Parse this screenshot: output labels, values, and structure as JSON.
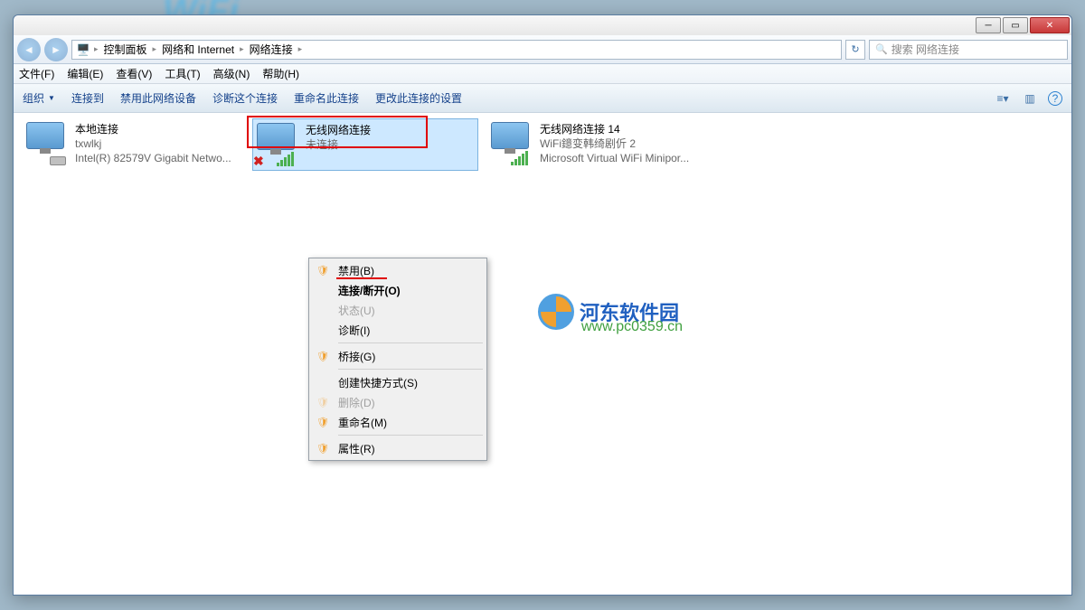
{
  "breadcrumb": {
    "p1": "控制面板",
    "p2": "网络和 Internet",
    "p3": "网络连接"
  },
  "search": {
    "placeholder": "搜索 网络连接"
  },
  "menubar": {
    "file": "文件(F)",
    "edit": "编辑(E)",
    "view": "查看(V)",
    "tools": "工具(T)",
    "advanced": "高级(N)",
    "help": "帮助(H)"
  },
  "toolbar": {
    "organize": "组织",
    "connect": "连接到",
    "disable": "禁用此网络设备",
    "diagnose": "诊断这个连接",
    "rename": "重命名此连接",
    "settings": "更改此连接的设置"
  },
  "connections": [
    {
      "title": "本地连接",
      "sub": "txwlkj",
      "dev": "Intel(R) 82579V Gigabit Netwo..."
    },
    {
      "title": "无线网络连接",
      "sub": "未连接",
      "dev": ""
    },
    {
      "title": "无线网络连接 14",
      "sub": "WiFi鐿变韩绮剧伒  2",
      "dev": "Microsoft Virtual WiFi Minipor..."
    }
  ],
  "contextmenu": {
    "disable": "禁用(B)",
    "disconnect": "连接/断开(O)",
    "status": "状态(U)",
    "diagnose": "诊断(I)",
    "bridge": "桥接(G)",
    "shortcut": "创建快捷方式(S)",
    "delete": "删除(D)",
    "rename": "重命名(M)",
    "properties": "属性(R)"
  },
  "watermark": {
    "text": "河东软件园",
    "url": "www.pc0359.cn"
  }
}
